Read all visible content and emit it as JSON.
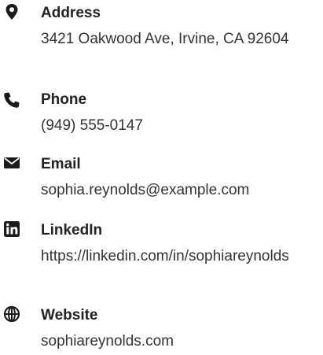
{
  "contact": {
    "address": {
      "icon": "map-marker-icon",
      "label": "Address",
      "value": "3421 Oakwood Ave, Irvine, CA 92604"
    },
    "phone": {
      "icon": "phone-icon",
      "label": "Phone",
      "value": "(949) 555-0147"
    },
    "email": {
      "icon": "envelope-icon",
      "label": "Email",
      "value": "sophia.reynolds@example.com"
    },
    "linkedin": {
      "icon": "linkedin-icon",
      "label": "LinkedIn",
      "value": "https://linkedin.com/in/sophiareynolds"
    },
    "website": {
      "icon": "globe-icon",
      "label": "Website",
      "value": "sophiareynolds.com"
    }
  },
  "colors": {
    "text": "#222222",
    "icon": "#1a1a1a"
  }
}
